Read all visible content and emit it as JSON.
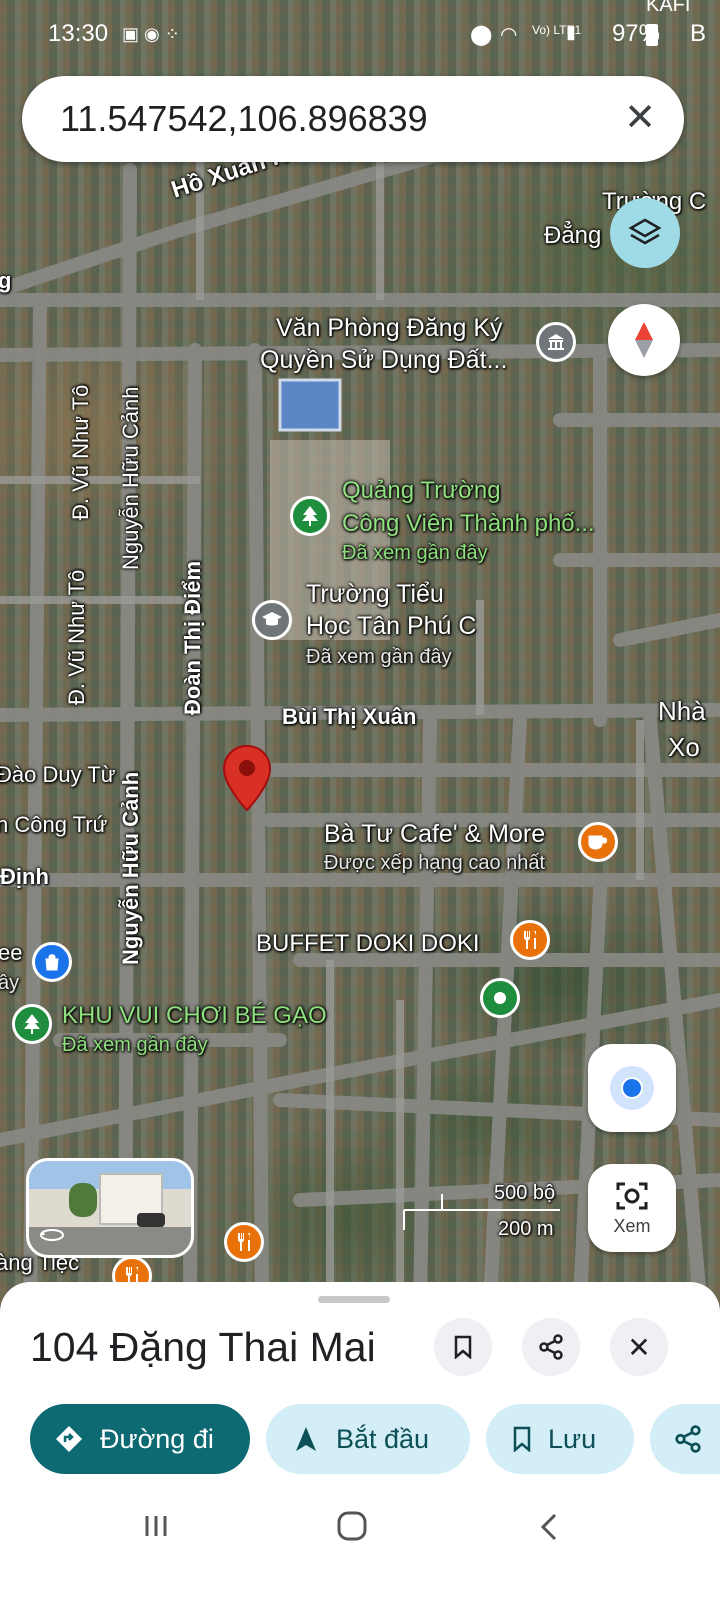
{
  "status_bar": {
    "time": "13:30",
    "battery": "97%",
    "network": "Vo) LTE1"
  },
  "search": {
    "query": "11.547542,106.896839"
  },
  "map": {
    "streets": {
      "ho_xuan_huong": "Hồ Xuân Hương",
      "vu_nhu_to_1": "Đ. Vũ Như Tô",
      "vu_nhu_to_2": "Đ. Vũ Như Tô",
      "nguyen_huu_canh_1": "Nguyễn Hữu Cảnh",
      "nguyen_huu_canh_2": "Nguyễn Hữu Cảnh",
      "doan_thi_diem": "Đoàn Thị Điểm",
      "bui_thi_xuan": "Bùi Thị Xuân",
      "dao_duy_tu": "Đào Duy Từ",
      "cong_tru": "n Công Trứ",
      "dinh": "Định",
      "edge_g": "g",
      "edge_ee": "ee",
      "edge_ay": "ây",
      "edge_ang_tiec": "àng Tiệc",
      "edge_nha": "Nhà",
      "edge_xo": "Xo",
      "edge_kafe": "KAFI",
      "edge_b": "B"
    },
    "places": {
      "van_phong_line1": "Văn Phòng Đăng Ký",
      "van_phong_line2": "Quyền Sử Dụng Đất...",
      "truong_top1": "Trường C",
      "truong_top2": "Đẳng",
      "quang_truong_line1": "Quảng Trường",
      "quang_truong_line2": "Công Viên Thành phố...",
      "quang_truong_sub": "Đã xem gần đây",
      "truong_tieu_hoc_line1": "Trường Tiểu",
      "truong_tieu_hoc_line2": "Học Tân Phú C",
      "truong_tieu_hoc_sub": "Đã xem gần đây",
      "ba_tu_cafe": "Bà Tư Cafe' & More",
      "ba_tu_cafe_sub": "Được xếp hạng cao nhất",
      "buffet": "BUFFET DOKI DOKI",
      "khu_vui_choi": "KHU VUI CHƠI BÉ GẠO",
      "khu_vui_choi_sub": "Đã xem gần đây"
    },
    "scale": {
      "imperial": "500 bộ",
      "metric": "200 m"
    },
    "lens_label": "Xem"
  },
  "colors": {
    "teal": "#0d6a73",
    "pill_bg": "#d3eef6",
    "pin_red": "#d93025",
    "poi_green": "#1e8e3e"
  },
  "sheet": {
    "title": "104 Đặng Thai Mai",
    "buttons": {
      "directions": "Đường đi",
      "start": "Bắt đầu",
      "save": "Lưu"
    }
  }
}
